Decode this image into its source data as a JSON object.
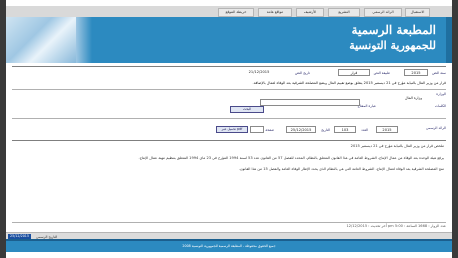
{
  "nav": {
    "home": "الاستقبال",
    "official_journal": "الرائد الرسمي",
    "legislation": "التشريع",
    "archive": "الأرشيف",
    "links": "مواقع هامة",
    "site_map": "خريطة الموقع"
  },
  "banner": {
    "title_line1": "المطبعة الرسمية",
    "title_line2": "للجمهورية التونسية"
  },
  "status_line": "عدد الزوار : 1668   الساعة : 5:00 pm   أخر تحديث : 12/12/2015",
  "section1": {
    "year_label": "سنة النص",
    "year_value": "2015",
    "type_label": "طبيعة النص",
    "type_value": "قرار",
    "date_label": "تاريخ النص",
    "date_value": "21/12/2015",
    "summary": "قرار من وزير المال بالنيابة مؤرخ في 21 ديسمبر 2015 يتعلق بوضع تقييم المال وبضع المصلحة الشرقية بعد الوفاة لعمال بالإضافة.",
    "ministry_label": "الوزارة",
    "ministry_value": "وزارة المال",
    "keyword_label": "الكلمات",
    "keyword2_label": "عبارة المفتاح",
    "search_button": "البحث"
  },
  "section2": {
    "label": "الرائد الرسمي",
    "year_label": "السنة",
    "year_value": "2015",
    "number_label": "العدد",
    "number_value": "103",
    "date_label": "التاريخ",
    "date_value": "25/12/2015",
    "page_label": "صفحة",
    "button": "تحميل عبر pdf"
  },
  "body_text": {
    "p1": "ملخص قرار من وزير المال بالنيابة مؤرخ في 21 ديسمبر 2015",
    "p2": "يرفع هيئة الوحدة بعد الوفاة من عمال الإنتاج، الشروط العامة في هذا القانون المتعلق بالنظام، المحدد للفصل 57 من القانون عدد 53 لسنة 1994 المؤرخ في 23 ماي 1994 المتعلق بتنظيم مهنة عمال الإنتاج.",
    "p3": "منح المصلحة الشرقية بعد الوفاة لعمال الإنتاج، الشروط العامة التي هي بالنظام الذي يحدد الإطار الوفاة العامة والفصل 15 من هذا القانون."
  },
  "footbar": {
    "date_badge": "25/12/2015",
    "date_label": "التاريخ الرسمي"
  },
  "footer": {
    "copyright": "جميع الحقوق محفوظة - المطبعة الرسمية للجمهورية التونسية 2008"
  }
}
